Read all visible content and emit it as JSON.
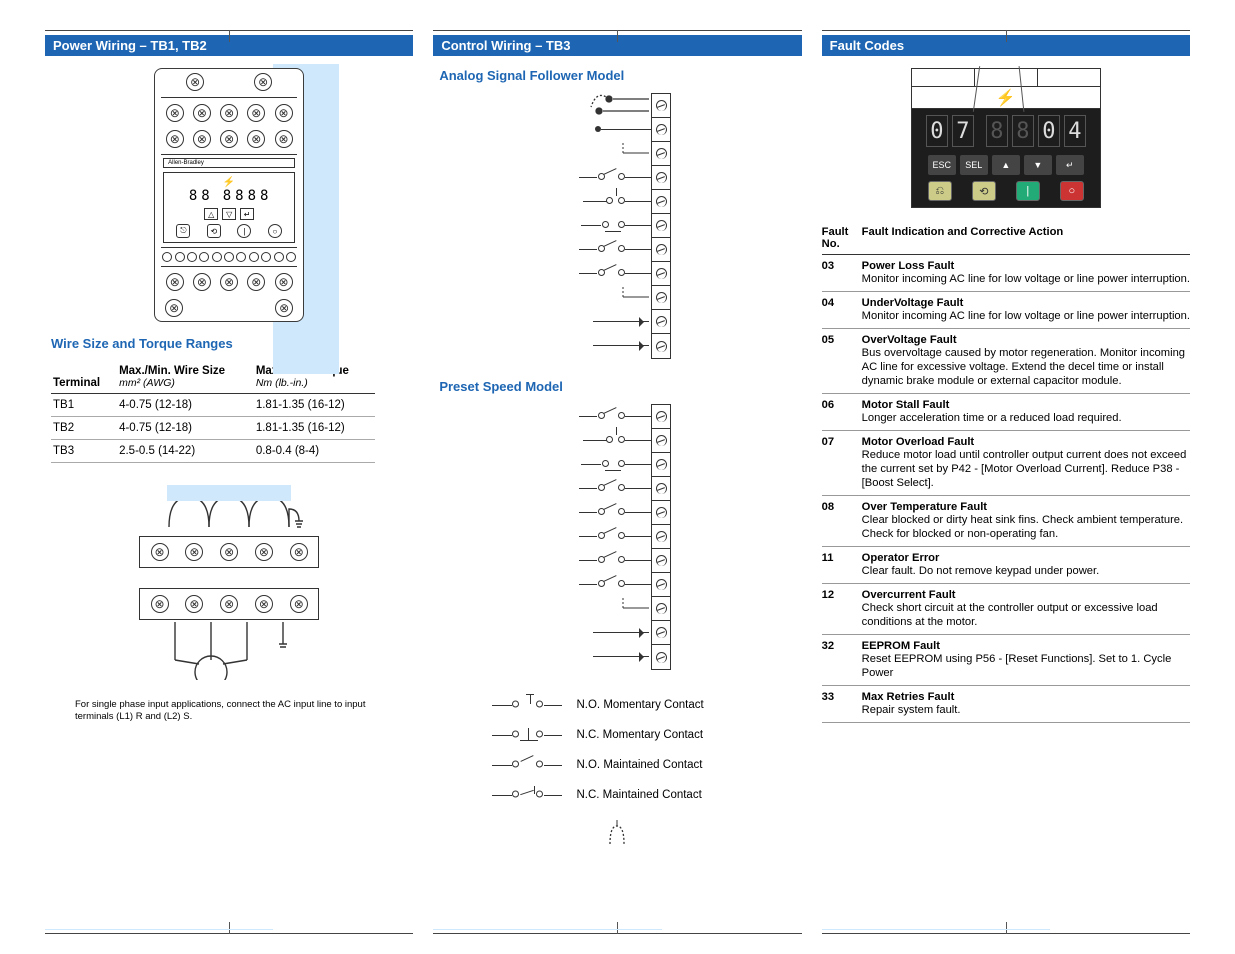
{
  "col1": {
    "header": "Power Wiring – TB1, TB2",
    "device_label": "Allen-Bradley",
    "sub1": "Wire Size and Torque Ranges",
    "table": {
      "h1": "Terminal",
      "h2a": "Max./Min. Wire Size",
      "h2b": "mm² (AWG)",
      "h3a": "Max./Min. Torque",
      "h3b": "Nm (lb.-in.)",
      "rows": [
        {
          "t": "TB1",
          "w": "4-0.75 (12-18)",
          "q": "1.81-1.35 (16-12)"
        },
        {
          "t": "TB2",
          "w": "4-0.75 (12-18)",
          "q": "1.81-1.35 (16-12)"
        },
        {
          "t": "TB3",
          "w": "2.5-0.5 (14-22)",
          "q": "0.8-0.4 (8-4)"
        }
      ]
    },
    "footnote": "For single phase input applications, connect the AC input line to input terminals (L1) R and (L2) S."
  },
  "col2": {
    "header": "Control Wiring – TB3",
    "sub1": "Analog Signal Follower Model",
    "sub2": "Preset Speed Model",
    "legend": {
      "l1": "N.O. Momentary Contact",
      "l2": "N.C. Momentary Contact",
      "l3": "N.O. Maintained Contact",
      "l4": "N.C. Maintained Contact"
    }
  },
  "col3": {
    "header": "Fault Codes",
    "display": {
      "d1": "0",
      "d2": "7",
      "d3": "",
      "d4": "0",
      "d5": "4"
    },
    "keys": {
      "k1": "ESC",
      "k2": "SEL",
      "k3": "▲",
      "k4": "▼",
      "k5": "↵"
    },
    "table_h1": "Fault No.",
    "table_h1a": "Fault",
    "table_h1b": "No.",
    "table_h2": "Fault Indication and Corrective Action",
    "faults": [
      {
        "n": "03",
        "t": "Power Loss Fault",
        "d": "Monitor incoming AC line for low voltage or line power interruption."
      },
      {
        "n": "04",
        "t": "UnderVoltage Fault",
        "d": "Monitor incoming AC line for low voltage or line power interruption."
      },
      {
        "n": "05",
        "t": "OverVoltage Fault",
        "d": "Bus overvoltage caused by motor regeneration. Monitor incoming AC line for excessive voltage. Extend the decel time or install dynamic brake module or external capacitor module."
      },
      {
        "n": "06",
        "t": "Motor Stall Fault",
        "d": "Longer acceleration time or a reduced load required."
      },
      {
        "n": "07",
        "t": "Motor Overload Fault",
        "d": "Reduce motor load until controller output current does not exceed the current set by P42 - [Motor Overload Current]. Reduce P38 - [Boost Select]."
      },
      {
        "n": "08",
        "t": "Over Temperature Fault",
        "d": "Clear blocked or dirty heat sink fins. Check ambient temperature. Check for blocked or non-operating fan."
      },
      {
        "n": "11",
        "t": "Operator Error",
        "d": "Clear fault. Do not remove keypad under power."
      },
      {
        "n": "12",
        "t": "Overcurrent Fault",
        "d": "Check short circuit at the controller output or excessive load conditions at the motor."
      },
      {
        "n": "32",
        "t": "EEPROM Fault",
        "d": "Reset EEPROM using P56 - [Reset Functions]. Set to 1. Cycle Power"
      },
      {
        "n": "33",
        "t": "Max Retries Fault",
        "d": "Repair system fault."
      }
    ]
  }
}
